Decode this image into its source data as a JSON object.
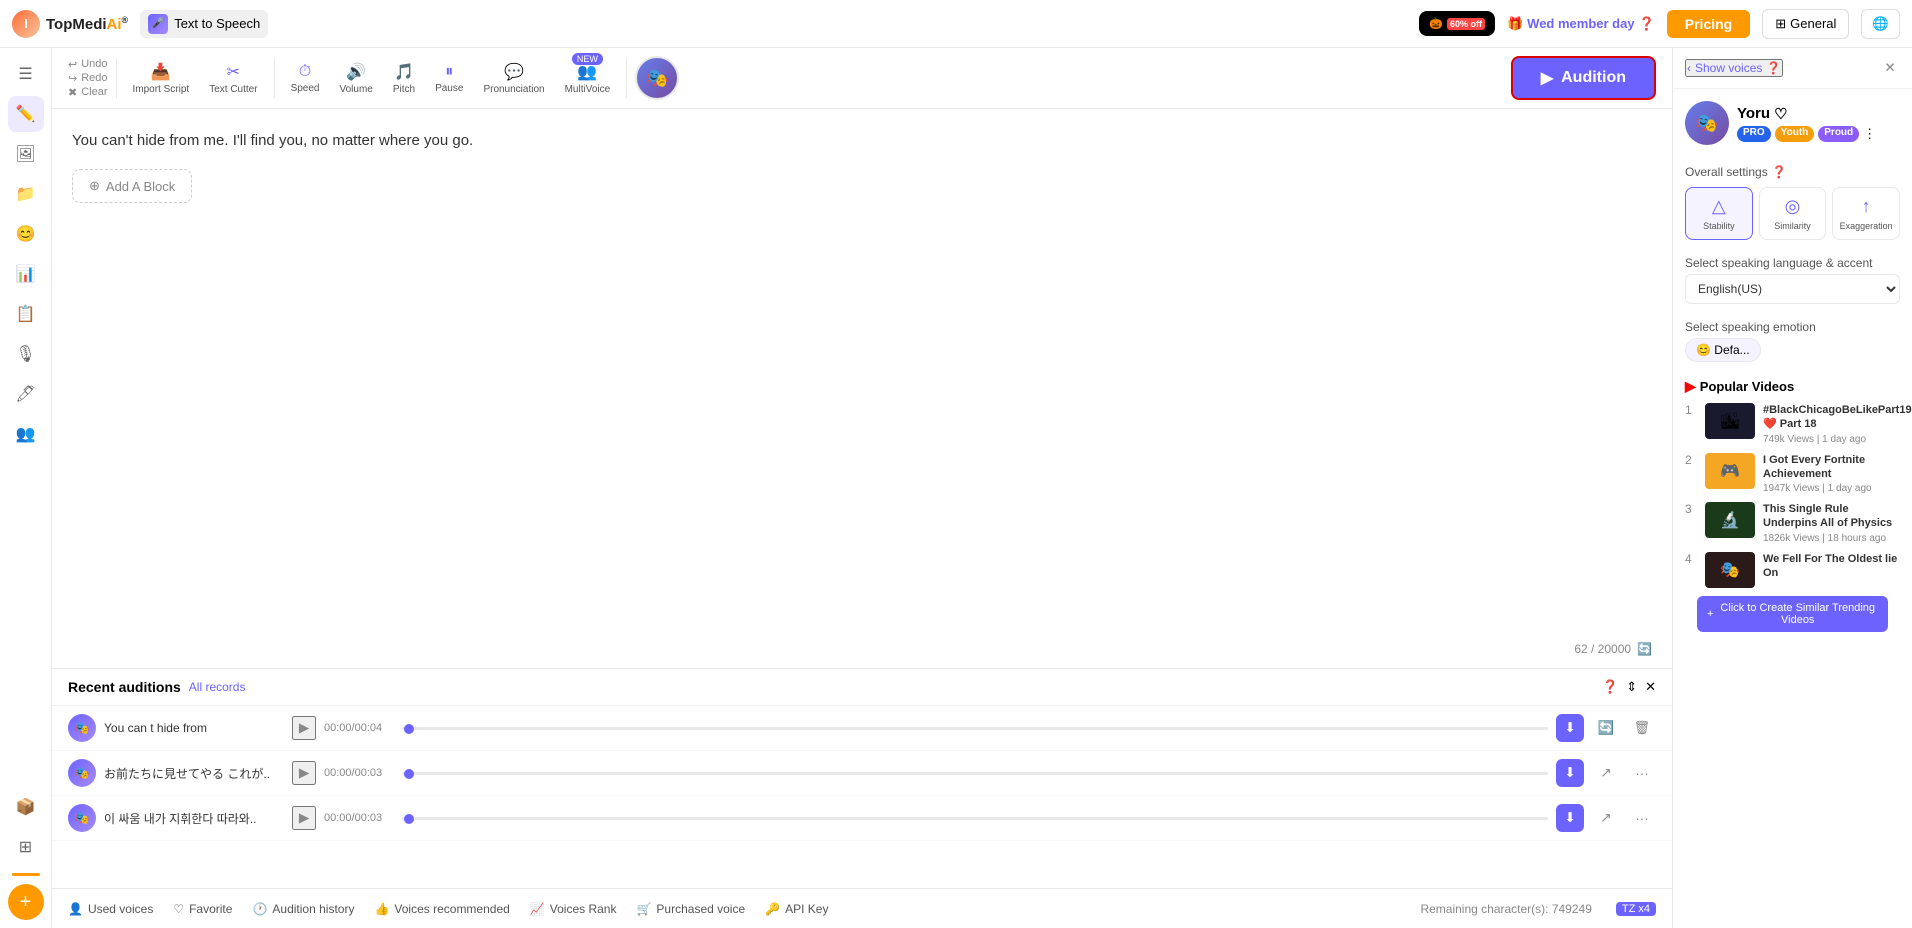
{
  "header": {
    "logo_text": "TopMediAi",
    "logo_reg": "®",
    "tts_label": "Text to Speech",
    "halloween_label": "Halloween",
    "halloween_badge": "60% off",
    "wed_member": "Wed member day",
    "pricing_label": "Pricing",
    "general_label": "General"
  },
  "toolbar": {
    "undo_label": "Undo",
    "redo_label": "Redo",
    "clear_label": "Clear",
    "import_script_label": "Import Script",
    "text_cutter_label": "Text Cutter",
    "speed_label": "Speed",
    "volume_label": "Volume",
    "pitch_label": "Pitch",
    "pause_label": "Pause",
    "pronunciation_label": "Pronunciation",
    "multivoice_label": "MultiVoice",
    "audition_label": "Audition",
    "new_badge": "NEW"
  },
  "editor": {
    "content": "You can't hide from me. I'll find you, no matter where you go.",
    "add_block": "Add A Block",
    "char_count": "62 / 20000"
  },
  "recent": {
    "title": "Recent auditions",
    "all_records": "All records",
    "rows": [
      {
        "name": "You can t hide from",
        "time": "00:00/00:04"
      },
      {
        "name": "お前たちに見せてやる これが..",
        "time": "00:00/00:03"
      },
      {
        "name": "이 싸움 내가 지휘한다 따라와..",
        "time": "00:00/00:03"
      }
    ]
  },
  "bottom_bar": {
    "used_voices": "Used voices",
    "favorite": "Favorite",
    "audition_history": "Audition history",
    "voices_recommended": "Voices recommended",
    "voices_rank": "Voices Rank",
    "purchased_voice": "Purchased voice",
    "api_key": "API Key",
    "remaining": "Remaining character(s): 749249",
    "tz_badge": "TZ x4"
  },
  "right_sidebar": {
    "show_voices": "Show voices",
    "voice_name": "Yoru",
    "tags": [
      "PRO",
      "Youth",
      "Proud"
    ],
    "overall_settings": "Overall settings",
    "settings": [
      {
        "label": "Stability",
        "icon": "△"
      },
      {
        "label": "Similarity",
        "icon": "◎"
      },
      {
        "label": "Exaggeration",
        "icon": "↑"
      }
    ],
    "language_label": "Select speaking language & accent",
    "language_value": "English(US)",
    "emotion_label": "Select speaking emotion",
    "emotion_value": "😊 Defa...",
    "popular_title": "Popular Videos",
    "videos": [
      {
        "num": "1",
        "title": "#BlackChicagoBeLikePart19 ❤️ Part 18",
        "meta": "749k Views | 1 day ago",
        "color": "#1a1a2e"
      },
      {
        "num": "2",
        "title": "I Got Every Fortnite Achievement",
        "meta": "1947k Views | 1 day ago",
        "color": "#f5a623"
      },
      {
        "num": "3",
        "title": "This Single Rule Underpins All of Physics",
        "meta": "1826k Views | 18 hours ago",
        "color": "#1a3a1a"
      },
      {
        "num": "4",
        "title": "We Fell For The Oldest lie On",
        "meta": "",
        "color": "#1a1a2e"
      }
    ],
    "create_similar": "Click to Create Similar Trending Videos"
  }
}
